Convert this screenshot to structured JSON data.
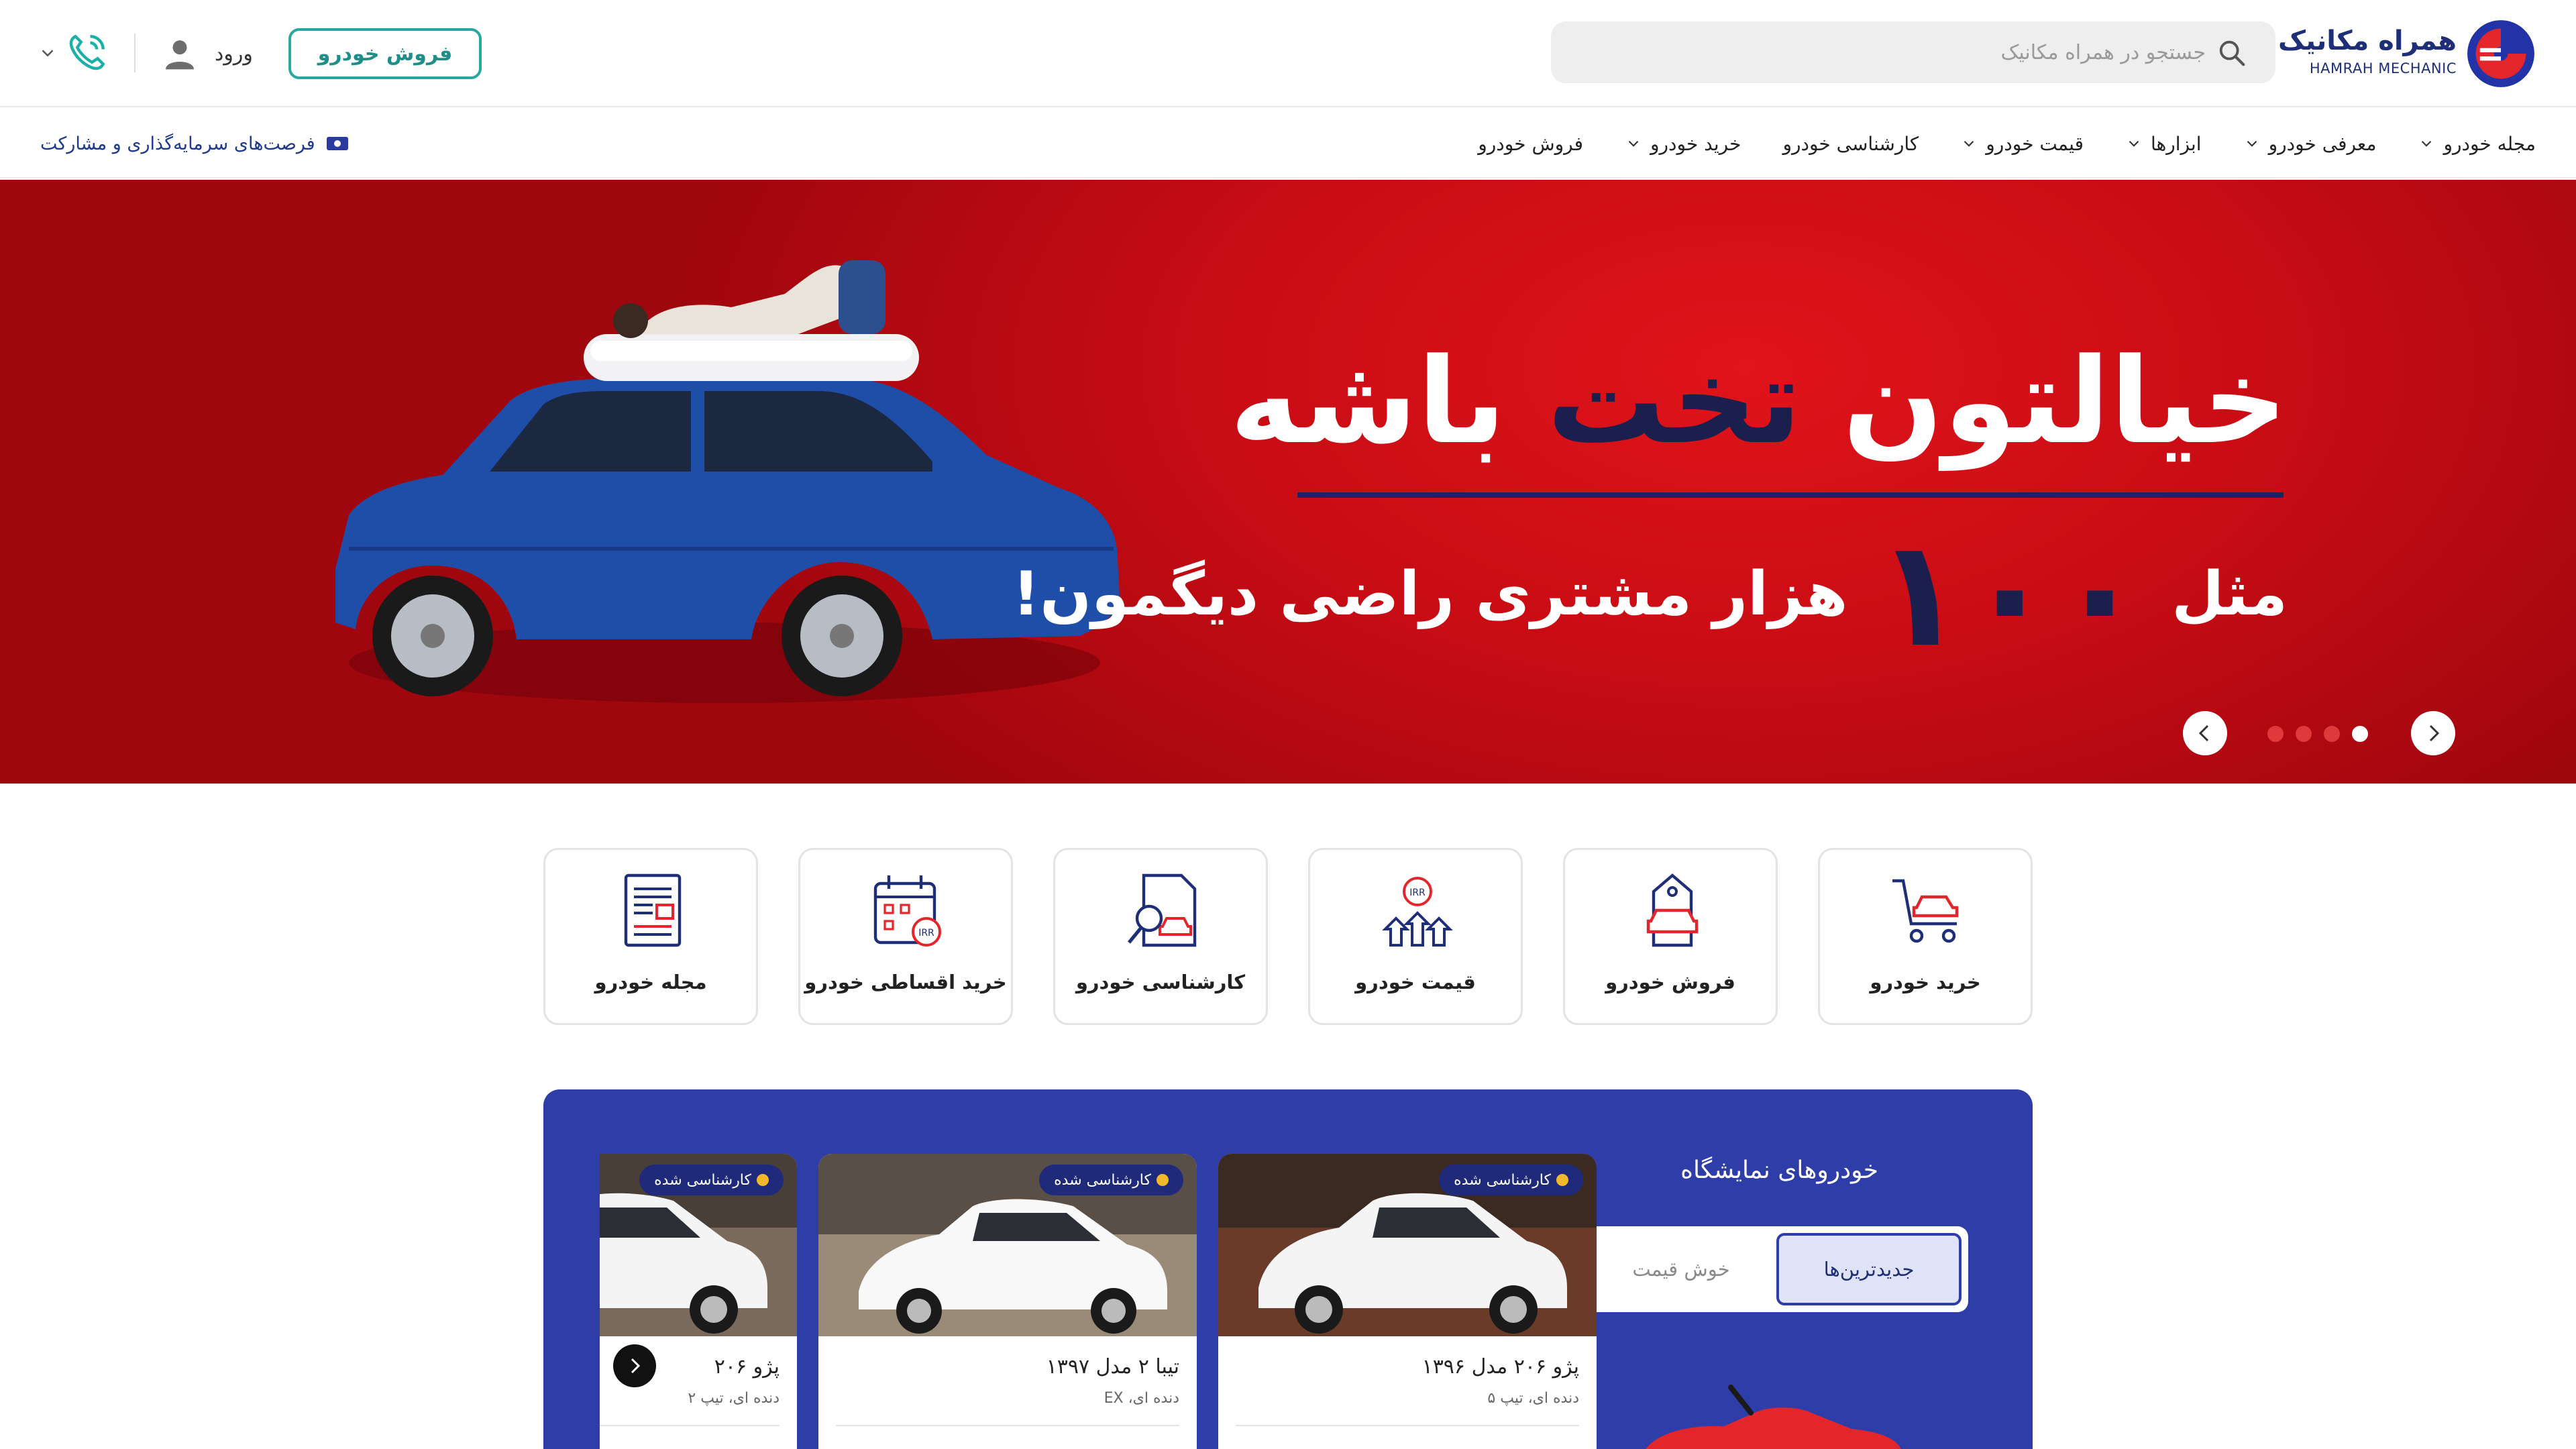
{
  "header": {
    "logo_fa": "همراه مکانیک",
    "logo_en": "HAMRAH MECHANIC",
    "search_placeholder": "جستجو در همراه مکانیک",
    "sell_button": "فروش خودرو",
    "login_label": "ورود"
  },
  "nav": {
    "items": [
      "فروش خودرو",
      "خرید خودرو",
      "کارشناسی خودرو",
      "قیمت خودرو",
      "ابزارها",
      "معرفی خودرو",
      "مجله خودرو"
    ],
    "invest_link": "فرصت‌های سرمایه‌گذاری و مشارکت"
  },
  "hero": {
    "title_part1": "خیالتون",
    "title_highlight": "تخت",
    "title_part2": "باشه",
    "sub_prefix": "مثل",
    "sub_number": "۱۰۰",
    "sub_suffix": "هزار مشتری راضی دیگمون!",
    "slides_count": 4,
    "active_slide": 1
  },
  "services": [
    {
      "label": "خرید خودرو",
      "icon": "cart-car-icon"
    },
    {
      "label": "فروش خودرو",
      "icon": "tag-car-icon"
    },
    {
      "label": "قیمت خودرو",
      "icon": "irr-chart-icon"
    },
    {
      "label": "کارشناسی خودرو",
      "icon": "inspection-doc-icon"
    },
    {
      "label": "خرید اقساطی خودرو",
      "icon": "calendar-irr-icon"
    },
    {
      "label": "مجله خودرو",
      "icon": "newspaper-icon"
    }
  ],
  "showroom": {
    "title": "خودروهای نمایشگاه",
    "tabs": [
      "جدیدترین‌ها",
      "خوش قیمت"
    ],
    "active_tab": 0,
    "badge": "کارشناسی شده",
    "cars": [
      {
        "title": "پژو ۲۰۶ مدل ۱۳۹۶",
        "sub": "دنده ای، تیپ ۵"
      },
      {
        "title": "تیبا ۲ مدل ۱۳۹۷",
        "sub": "دنده ای، EX"
      },
      {
        "title": "پژو ۲۰۶",
        "sub": "دنده ای، تیپ ۲"
      }
    ]
  },
  "colors": {
    "brand_navy": "#1e2f78",
    "teal": "#2aa7a1",
    "hero_red": "#c80c14",
    "panel_blue": "#2e3da8"
  }
}
